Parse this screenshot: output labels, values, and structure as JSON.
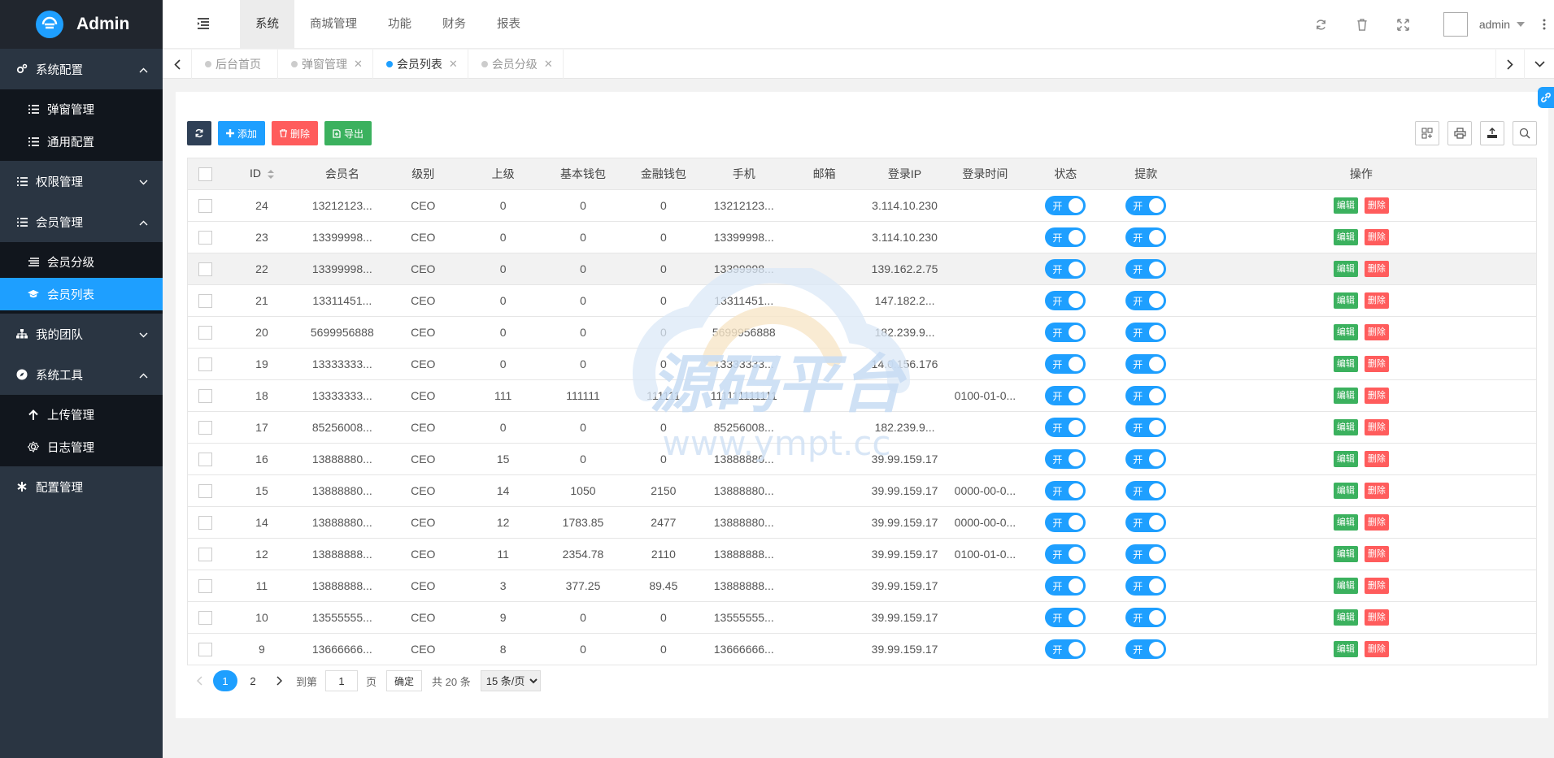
{
  "app": {
    "title": "Admin"
  },
  "sidebar": {
    "groups": [
      {
        "label": "系统配置",
        "icon": "gears-icon",
        "expanded": true,
        "items": [
          {
            "label": "弹窗管理",
            "icon": "list-icon"
          },
          {
            "label": "通用配置",
            "icon": "list-icon"
          }
        ]
      },
      {
        "label": "权限管理",
        "icon": "list-icon",
        "expanded": false,
        "items": []
      },
      {
        "label": "会员管理",
        "icon": "list-icon",
        "expanded": true,
        "items": [
          {
            "label": "会员分级",
            "icon": "bars-icon"
          },
          {
            "label": "会员列表",
            "icon": "graduation-cap-icon",
            "active": true
          }
        ]
      },
      {
        "label": "我的团队",
        "icon": "sitemap-icon",
        "expanded": false,
        "items": []
      },
      {
        "label": "系统工具",
        "icon": "compass-icon",
        "expanded": true,
        "items": [
          {
            "label": "上传管理",
            "icon": "arrow-up-icon"
          },
          {
            "label": "日志管理",
            "icon": "gear-icon"
          }
        ]
      },
      {
        "label": "配置管理",
        "icon": "asterisk-icon",
        "expanded": false,
        "items": []
      }
    ]
  },
  "header": {
    "nav": [
      "系统",
      "商城管理",
      "功能",
      "财务",
      "报表"
    ],
    "active_nav": "系统",
    "user": "admin"
  },
  "tabs": [
    {
      "label": "后台首页",
      "closable": false
    },
    {
      "label": "弹窗管理",
      "closable": true
    },
    {
      "label": "会员列表",
      "closable": true,
      "active": true
    },
    {
      "label": "会员分级",
      "closable": true
    }
  ],
  "toolbar": {
    "add": "添加",
    "delete": "删除",
    "export": "导出"
  },
  "table": {
    "columns": [
      "ID",
      "会员名",
      "级别",
      "上级",
      "基本钱包",
      "金融钱包",
      "手机",
      "邮箱",
      "登录IP",
      "登录时间",
      "状态",
      "提款",
      "操作"
    ],
    "switch_label": "开",
    "edit_label": "编辑",
    "delete_label": "删除",
    "rows": [
      {
        "id": "24",
        "name": "13212123...",
        "level": "CEO",
        "parent": "0",
        "basic": "0",
        "finance": "0",
        "phone": "13212123...",
        "email": "",
        "ip": "3.114.10.230",
        "time": ""
      },
      {
        "id": "23",
        "name": "13399998...",
        "level": "CEO",
        "parent": "0",
        "basic": "0",
        "finance": "0",
        "phone": "13399998...",
        "email": "",
        "ip": "3.114.10.230",
        "time": ""
      },
      {
        "id": "22",
        "name": "13399998...",
        "level": "CEO",
        "parent": "0",
        "basic": "0",
        "finance": "0",
        "phone": "13399998...",
        "email": "",
        "ip": "139.162.2.75",
        "time": "",
        "highlight": true
      },
      {
        "id": "21",
        "name": "13311451...",
        "level": "CEO",
        "parent": "0",
        "basic": "0",
        "finance": "0",
        "phone": "13311451...",
        "email": "",
        "ip": "147.182.2...",
        "time": ""
      },
      {
        "id": "20",
        "name": "5699956888",
        "level": "CEO",
        "parent": "0",
        "basic": "0",
        "finance": "0",
        "phone": "5699956888",
        "email": "",
        "ip": "182.239.9...",
        "time": ""
      },
      {
        "id": "19",
        "name": "13333333...",
        "level": "CEO",
        "parent": "0",
        "basic": "0",
        "finance": "0",
        "phone": "13333333...",
        "email": "",
        "ip": "14.0.156.176",
        "time": ""
      },
      {
        "id": "18",
        "name": "13333333...",
        "level": "CEO",
        "parent": "111",
        "basic": "111111",
        "finance": "111111",
        "phone": "111111111111",
        "email": "",
        "ip": "",
        "time": "0100-01-0..."
      },
      {
        "id": "17",
        "name": "85256008...",
        "level": "CEO",
        "parent": "0",
        "basic": "0",
        "finance": "0",
        "phone": "85256008...",
        "email": "",
        "ip": "182.239.9...",
        "time": ""
      },
      {
        "id": "16",
        "name": "13888880...",
        "level": "CEO",
        "parent": "15",
        "basic": "0",
        "finance": "0",
        "phone": "13888880...",
        "email": "",
        "ip": "39.99.159.17",
        "time": ""
      },
      {
        "id": "15",
        "name": "13888880...",
        "level": "CEO",
        "parent": "14",
        "basic": "1050",
        "finance": "2150",
        "phone": "13888880...",
        "email": "",
        "ip": "39.99.159.17",
        "time": "0000-00-0..."
      },
      {
        "id": "14",
        "name": "13888880...",
        "level": "CEO",
        "parent": "12",
        "basic": "1783.85",
        "finance": "2477",
        "phone": "13888880...",
        "email": "",
        "ip": "39.99.159.17",
        "time": "0000-00-0..."
      },
      {
        "id": "12",
        "name": "13888888...",
        "level": "CEO",
        "parent": "11",
        "basic": "2354.78",
        "finance": "2110",
        "phone": "13888888...",
        "email": "",
        "ip": "39.99.159.17",
        "time": "0100-01-0..."
      },
      {
        "id": "11",
        "name": "13888888...",
        "level": "CEO",
        "parent": "3",
        "basic": "377.25",
        "finance": "89.45",
        "phone": "13888888...",
        "email": "",
        "ip": "39.99.159.17",
        "time": ""
      },
      {
        "id": "10",
        "name": "13555555...",
        "level": "CEO",
        "parent": "9",
        "basic": "0",
        "finance": "0",
        "phone": "13555555...",
        "email": "",
        "ip": "39.99.159.17",
        "time": ""
      },
      {
        "id": "9",
        "name": "13666666...",
        "level": "CEO",
        "parent": "8",
        "basic": "0",
        "finance": "0",
        "phone": "13666666...",
        "email": "",
        "ip": "39.99.159.17",
        "time": ""
      }
    ]
  },
  "pager": {
    "pages": [
      "1",
      "2"
    ],
    "current": "1",
    "goto_prefix": "到第",
    "goto_value": "1",
    "goto_suffix": "页",
    "confirm": "确定",
    "total": "共 20 条",
    "page_size": "15 条/页"
  },
  "watermark": {
    "text": "源码平台",
    "url": "www.ympt.cc"
  },
  "colors": {
    "accent": "#1e9fff",
    "sidebar": "#2a3542",
    "danger": "#ff5c5c",
    "success": "#3bb15e"
  }
}
